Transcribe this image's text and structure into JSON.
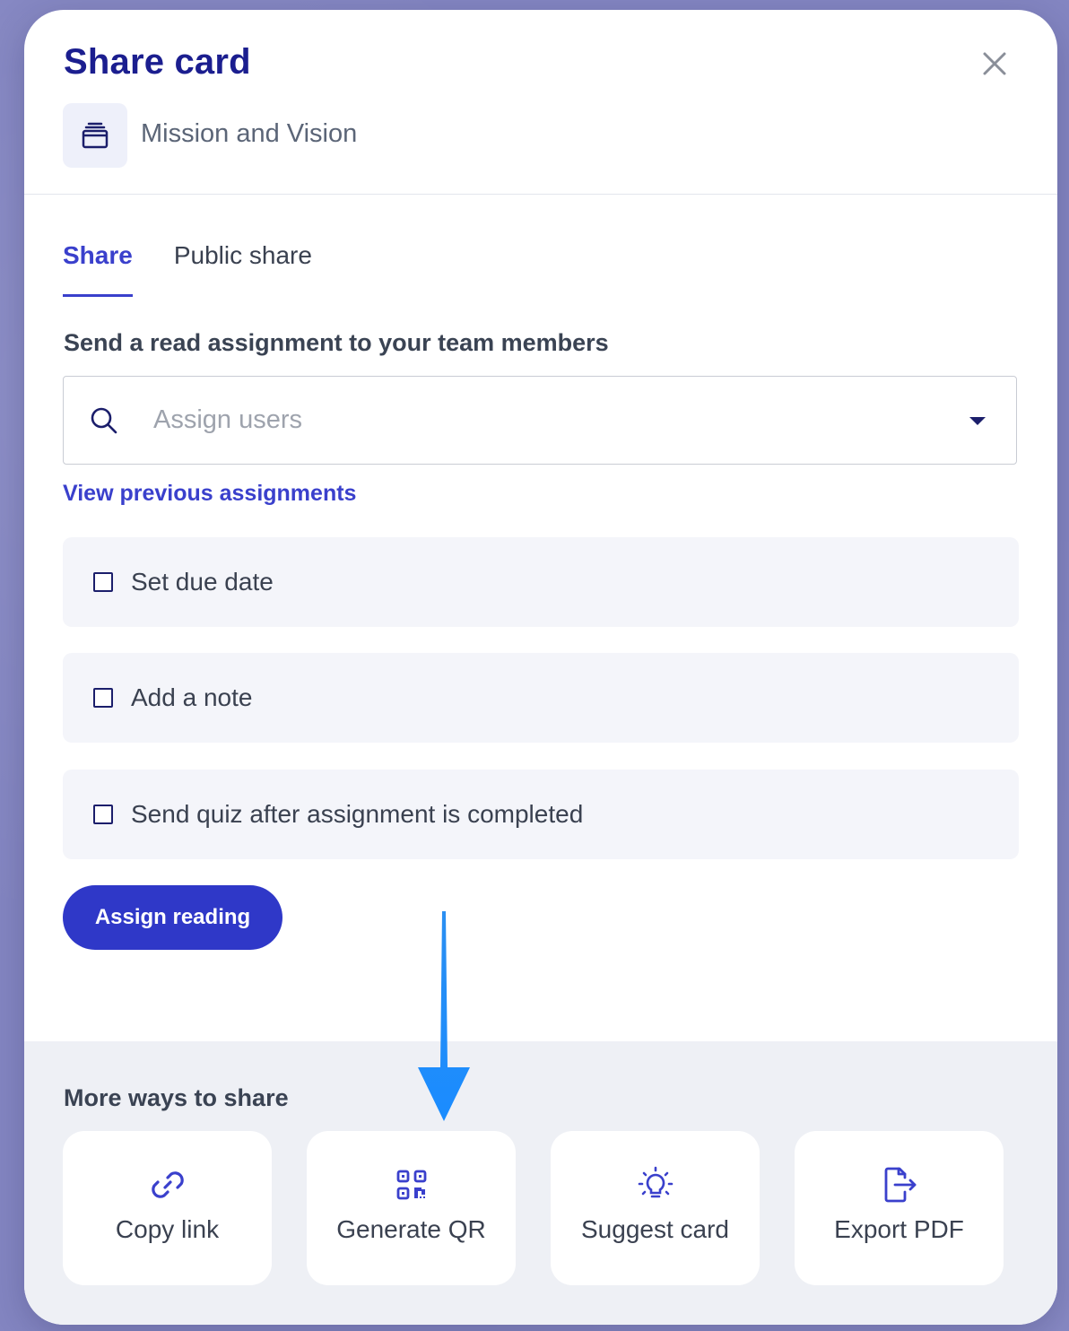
{
  "modal": {
    "title": "Share card",
    "card_name": "Mission and Vision",
    "card_icon": "stack-icon",
    "close_icon": "close-icon"
  },
  "tabs": [
    {
      "label": "Share",
      "active": true
    },
    {
      "label": "Public share",
      "active": false
    }
  ],
  "assignment": {
    "section_title": "Send a read assignment to your team members",
    "input_placeholder": "Assign users",
    "input_value": "",
    "view_previous_label": "View previous assignments",
    "options": [
      {
        "label": "Set due date",
        "checked": false
      },
      {
        "label": "Add a note",
        "checked": false
      },
      {
        "label": "Send quiz after assignment is completed",
        "checked": false
      }
    ],
    "assign_button_label": "Assign reading"
  },
  "more_ways": {
    "title": "More ways to share",
    "items": [
      {
        "label": "Copy link",
        "icon": "link-icon"
      },
      {
        "label": "Generate QR",
        "icon": "qr-code-icon"
      },
      {
        "label": "Suggest card",
        "icon": "lightbulb-icon"
      },
      {
        "label": "Export PDF",
        "icon": "export-file-icon"
      }
    ]
  },
  "colors": {
    "primary": "#2f38c8",
    "title": "#1b1e8f",
    "icon_accent": "#3a40cc",
    "annotation_arrow": "#1e90ff"
  }
}
